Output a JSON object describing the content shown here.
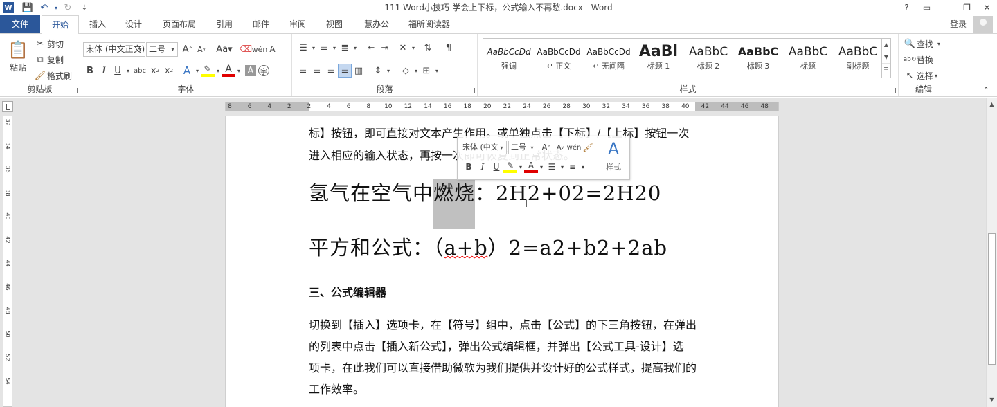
{
  "window": {
    "title": "111-Word小技巧-学会上下标，公式输入不再愁.docx - Word",
    "logo": "W",
    "controls": [
      "?",
      "▭",
      "–",
      "❐",
      "✕"
    ]
  },
  "tabs": {
    "file": "文件",
    "items": [
      "开始",
      "插入",
      "设计",
      "页面布局",
      "引用",
      "邮件",
      "审阅",
      "视图",
      "慧办公",
      "福昕阅读器"
    ],
    "active": "开始",
    "login": "登录"
  },
  "ribbon": {
    "clipboard": {
      "label": "剪贴板",
      "paste": "粘贴",
      "cut": "剪切",
      "copy": "复制",
      "format_painter": "格式刷"
    },
    "font": {
      "label": "字体",
      "font_name": "宋体 (中文正文)",
      "font_size": "二号",
      "aa_label": "Aa"
    },
    "paragraph": {
      "label": "段落"
    },
    "styles": {
      "label": "样式",
      "items": [
        {
          "preview": "AaBbCcDd",
          "name": "强调"
        },
        {
          "preview": "AaBbCcDd",
          "name": "↵ 正文"
        },
        {
          "preview": "AaBbCcDd",
          "name": "↵ 无间隔"
        },
        {
          "preview": "AaBl",
          "name": "标题 1"
        },
        {
          "preview": "AaBbC",
          "name": "标题 2"
        },
        {
          "preview": "AaBbC",
          "name": "标题 3"
        },
        {
          "preview": "AaBbC",
          "name": "标题"
        },
        {
          "preview": "AaBbC",
          "name": "副标题"
        }
      ]
    },
    "editing": {
      "label": "编辑",
      "find": "查找",
      "replace": "替换",
      "select": "选择"
    }
  },
  "ruler": {
    "h_ticks": [
      "8",
      "6",
      "4",
      "2",
      "2",
      "4",
      "6",
      "8",
      "10",
      "12",
      "14",
      "16",
      "18",
      "20",
      "22",
      "24",
      "26",
      "28",
      "30",
      "32",
      "34",
      "36",
      "38",
      "40",
      "42",
      "44",
      "46",
      "48"
    ],
    "v_ticks": [
      "32",
      "34",
      "36",
      "38",
      "40",
      "42",
      "44",
      "46",
      "48",
      "50",
      "52",
      "54"
    ]
  },
  "document": {
    "line1": "标】按钮，即可直接对文本产生作用。或单独点击【下标】/【上标】按钮一次",
    "line2": "进入相应的输入状态，再按一次即可恢复到正常状态。",
    "formula1_a": "氢气在空气中",
    "formula1_sel": "燃烧",
    "formula1_b": "：2H2+02=2H20",
    "formula2_a": "平方和公式：（",
    "formula2_sq": "a+b",
    "formula2_b": "）2=a2+b2+2ab",
    "heading3": "三、公式编辑器",
    "para": [
      "切换到【插入】选项卡，在【符号】组中，点击【公式】的下三角按钮，在弹出",
      "的列表中点击【插入新公式】，弹出公式编辑框，并弹出【公式工具-设计】选",
      "项卡，在此我们可以直接借助微软为我们提供并设计好的公式样式，提高我们的",
      "工作效率。"
    ]
  },
  "minitoolbar": {
    "font_name": "宋体 (中文",
    "font_size": "二号",
    "styles": "样式"
  },
  "colors": {
    "accent": "#2b579a",
    "highlight": "#ffff00",
    "font_red": "#e00000"
  }
}
